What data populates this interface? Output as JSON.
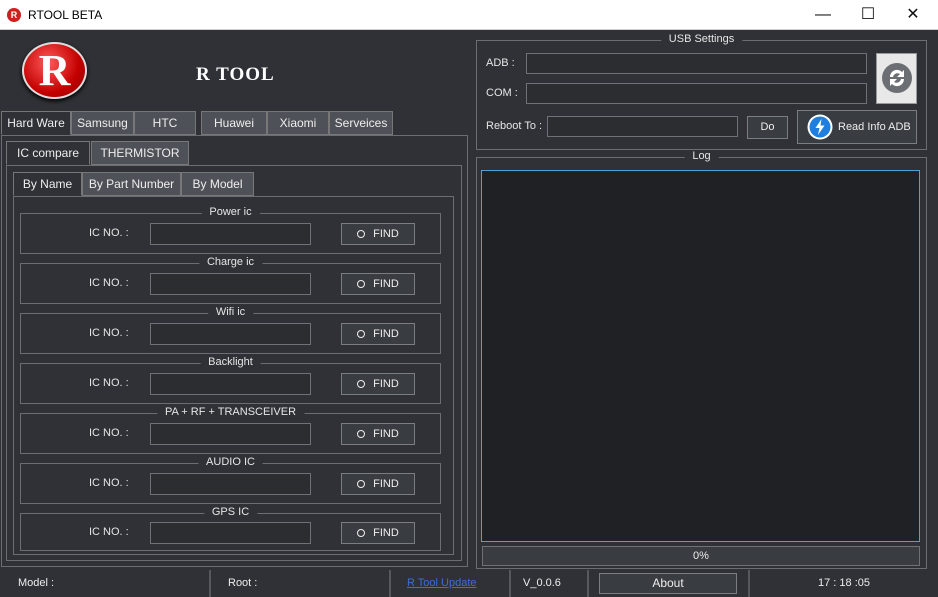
{
  "window": {
    "title": "RTOOL  BETA",
    "icon_letter": "R",
    "minimize": "—",
    "maximize": "☐",
    "close": "✕"
  },
  "app": {
    "logo_letter": "R",
    "title": "R TOOL"
  },
  "main_tabs": [
    "Hard Ware",
    "Samsung",
    "HTC",
    "Huawei",
    "Xiaomi",
    "Serveices"
  ],
  "sub_tabs": [
    "IC compare",
    "THERMISTOR"
  ],
  "search_tabs": [
    "By Name",
    "By Part Number",
    "By Model"
  ],
  "ic_groups": [
    {
      "title": "Power ic",
      "label": "IC NO. :",
      "value": "",
      "button": "FIND"
    },
    {
      "title": "Charge ic",
      "label": "IC NO. :",
      "value": "",
      "button": "FIND"
    },
    {
      "title": "Wifi ic",
      "label": "IC NO. :",
      "value": "",
      "button": "FIND"
    },
    {
      "title": "Backlight",
      "label": "IC NO. :",
      "value": "",
      "button": "FIND"
    },
    {
      "title": "PA  + RF   + TRANSCEIVER",
      "label": "IC NO. :",
      "value": "",
      "button": "FIND"
    },
    {
      "title": "AUDIO IC",
      "label": "IC NO. :",
      "value": "",
      "button": "FIND"
    },
    {
      "title": "GPS IC",
      "label": "IC NO. :",
      "value": "",
      "button": "FIND"
    }
  ],
  "usb": {
    "title": "USB Settings",
    "adb_label": "ADB :",
    "adb_value": "",
    "com_label": "COM :",
    "com_value": "",
    "reboot_label": "Reboot To :",
    "reboot_value": "",
    "do_button": "Do",
    "read_info_button": "Read Info ADB"
  },
  "log": {
    "title": "Log",
    "progress": "0%"
  },
  "status": {
    "model": "Model :",
    "root": "Root :",
    "update_link": "R Tool Update",
    "version": "V_0.0.6",
    "about": "About",
    "time": "17 : 18 :05"
  },
  "colors": {
    "background": "#2f3136",
    "log_border": "#4aa3df",
    "logo_red": "#c40000",
    "link": "#3a6fd8"
  }
}
